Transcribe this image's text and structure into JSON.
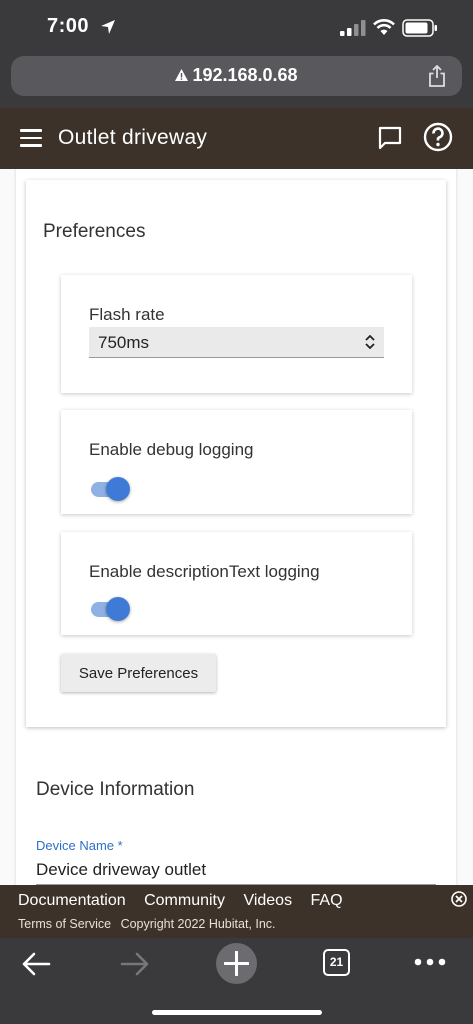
{
  "status_bar": {
    "time": "7:00"
  },
  "browser": {
    "url": "192.168.0.68",
    "tab_count": "21"
  },
  "header": {
    "title": "Outlet driveway"
  },
  "preferences": {
    "title": "Preferences",
    "flash_rate": {
      "label": "Flash rate",
      "value": "750ms"
    },
    "debug_logging": {
      "label": "Enable debug logging",
      "enabled": true
    },
    "description_logging": {
      "label": "Enable descriptionText logging",
      "enabled": true
    },
    "save_label": "Save Preferences"
  },
  "device_info": {
    "title": "Device Information",
    "device_name_label": "Device Name *",
    "device_name_value": "Device driveway outlet"
  },
  "footer": {
    "links": [
      "Documentation",
      "Community",
      "Videos",
      "FAQ"
    ],
    "terms": "Terms of Service",
    "copyright": "Copyright 2022 Hubitat, Inc."
  },
  "colors": {
    "header_bg": "#3c3229",
    "toggle_on": "#3f7bd6",
    "label_blue": "#2f6fc8"
  }
}
